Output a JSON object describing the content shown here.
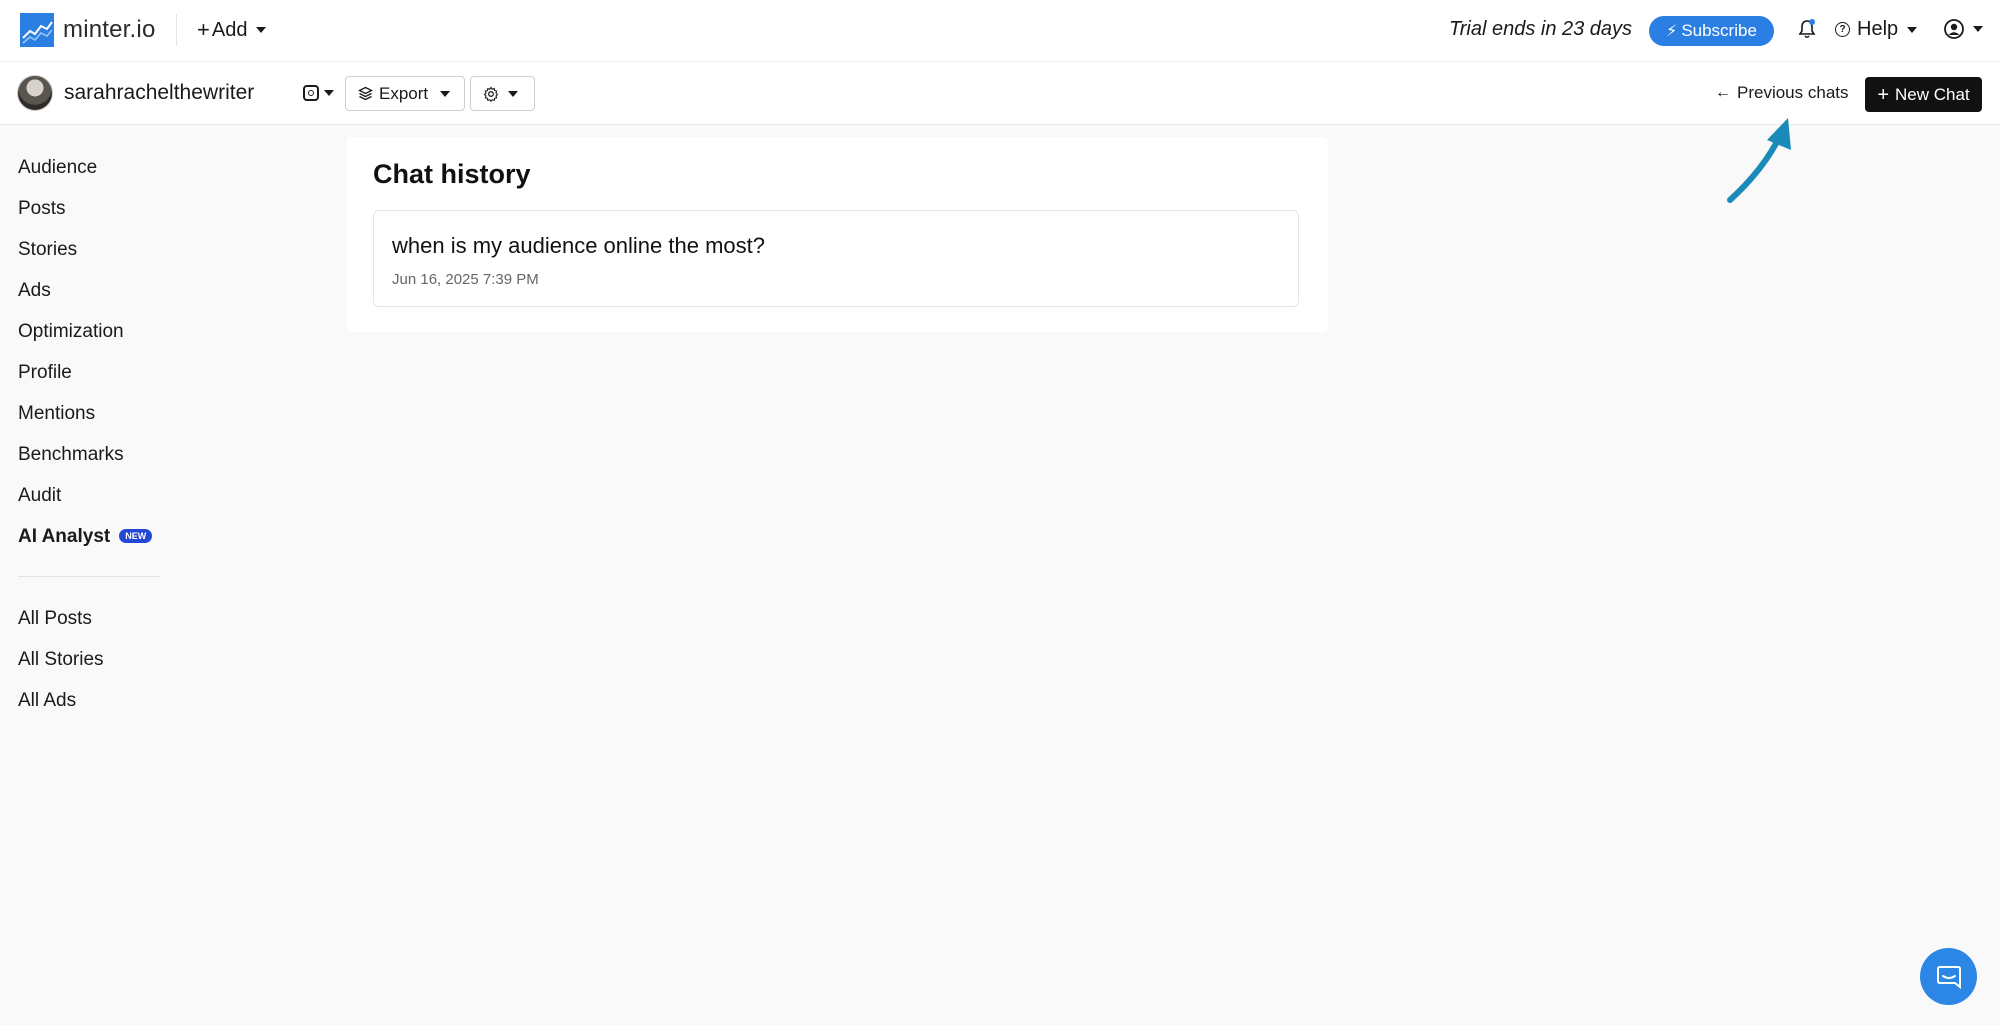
{
  "brand": {
    "logo_text": "minter.io",
    "accent": "#2b7fe3"
  },
  "topbar": {
    "add_label": "Add",
    "trial_text": "Trial ends in 23 days",
    "subscribe_label": "Subscribe",
    "help_label": "Help"
  },
  "profile": {
    "username": "sarahrachelthewriter",
    "network_icon": "instagram-icon"
  },
  "toolbar": {
    "export_label": "Export",
    "previous_chats_label": "Previous chats",
    "new_chat_label": "New Chat"
  },
  "sidebar": {
    "items": [
      {
        "label": "Audience"
      },
      {
        "label": "Posts"
      },
      {
        "label": "Stories"
      },
      {
        "label": "Ads"
      },
      {
        "label": "Optimization"
      },
      {
        "label": "Profile"
      },
      {
        "label": "Mentions"
      },
      {
        "label": "Benchmarks"
      },
      {
        "label": "Audit"
      },
      {
        "label": "AI Analyst",
        "badge": "NEW"
      }
    ],
    "secondary_items": [
      {
        "label": "All Posts"
      },
      {
        "label": "All Stories"
      },
      {
        "label": "All Ads"
      }
    ]
  },
  "history": {
    "title": "Chat history",
    "chats": [
      {
        "question": "when is my audience online the most?",
        "date": "Jun 16, 2025 7:39 PM"
      }
    ]
  }
}
